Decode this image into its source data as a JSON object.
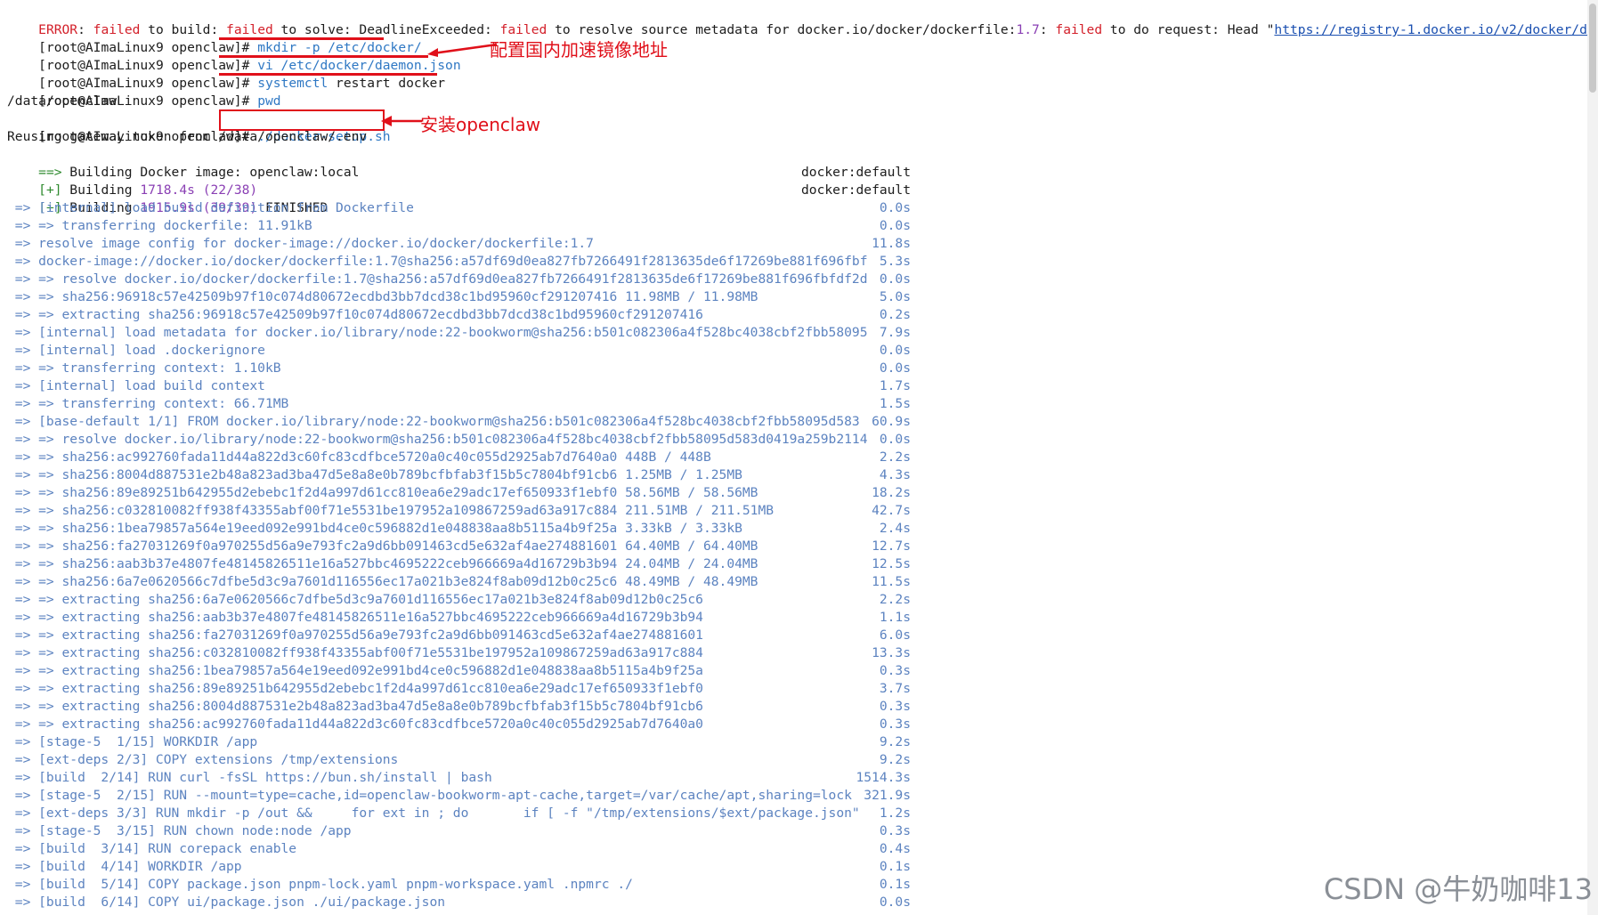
{
  "error_line": {
    "label": "ERROR",
    "parts": [
      [
        ": ",
        "black"
      ],
      [
        "failed",
        "red"
      ],
      [
        " to build: ",
        "black"
      ],
      [
        "failed",
        "red"
      ],
      [
        " to solve: DeadlineExceeded: ",
        "black"
      ],
      [
        "failed",
        "red"
      ],
      [
        " to resolve source metadata for docker.io/docker/dockerfile:",
        "black"
      ],
      [
        "1.7",
        "purple"
      ],
      [
        ": ",
        "black"
      ],
      [
        "failed",
        "red"
      ],
      [
        " to do request: Head \"",
        "black"
      ]
    ],
    "url": "https://registry-1.docker.io/v2/docker/docke"
  },
  "prompt": "[root@AImaLinux9 openclaw]",
  "commands": [
    {
      "cmd": "mkdir",
      "args": " -p /etc/docker/"
    },
    {
      "cmd": "vi",
      "args": " /etc/docker/daemon.json"
    },
    {
      "cmd": "systemctl",
      "args": " restart docker"
    },
    {
      "cmd": "pwd",
      "args": ""
    }
  ],
  "pwd_output": "/data/openclaw",
  "setup_cmd": "./docker-setup.sh",
  "reuse_line": "Reusing gateway token from /data/openclaw/.env",
  "building_image": {
    "prefix": "==>",
    "text": " Building Docker image: openclaw:local"
  },
  "progress": [
    {
      "tag": "[+]",
      "label": " Building ",
      "time": "1718.4s",
      "count": "(22/38)",
      "suffix": "",
      "ctx": "docker:default"
    },
    {
      "tag": "[+]",
      "label": " Building ",
      "time": "1915.9s",
      "count": "(39/39)",
      "suffix": " FINISHED",
      "ctx": "docker:default"
    }
  ],
  "steps": [
    {
      "text": " => [internal] load build definition from Dockerfile",
      "time": "0.0s"
    },
    {
      "text": " => => transferring dockerfile: 11.91kB",
      "time": "0.0s"
    },
    {
      "text": " => resolve image config for docker-image://docker.io/docker/dockerfile:1.7",
      "time": "11.8s"
    },
    {
      "text": " => docker-image://docker.io/docker/dockerfile:1.7@sha256:a57df69d0ea827fb7266491f2813635de6f17269be881f696fbf",
      "time": "5.3s"
    },
    {
      "text": " => => resolve docker.io/docker/dockerfile:1.7@sha256:a57df69d0ea827fb7266491f2813635de6f17269be881f696fbfdf2d",
      "time": "0.0s"
    },
    {
      "text": " => => sha256:96918c57e42509b97f10c074d80672ecdbd3bb7dcd38c1bd95960cf291207416 11.98MB / 11.98MB",
      "time": "5.0s"
    },
    {
      "text": " => => extracting sha256:96918c57e42509b97f10c074d80672ecdbd3bb7dcd38c1bd95960cf291207416",
      "time": "0.2s"
    },
    {
      "text": " => [internal] load metadata for docker.io/library/node:22-bookworm@sha256:b501c082306a4f528bc4038cbf2fbb58095",
      "time": "7.9s"
    },
    {
      "text": " => [internal] load .dockerignore",
      "time": "0.0s"
    },
    {
      "text": " => => transferring context: 1.10kB",
      "time": "0.0s"
    },
    {
      "text": " => [internal] load build context",
      "time": "1.7s"
    },
    {
      "text": " => => transferring context: 66.71MB",
      "time": "1.5s"
    },
    {
      "text": " => [base-default 1/1] FROM docker.io/library/node:22-bookworm@sha256:b501c082306a4f528bc4038cbf2fbb58095d583",
      "time": "60.9s"
    },
    {
      "text": " => => resolve docker.io/library/node:22-bookworm@sha256:b501c082306a4f528bc4038cbf2fbb58095d583d0419a259b2114",
      "time": "0.0s"
    },
    {
      "text": " => => sha256:ac992760fada11d44a822d3c60fc83cdfbce5720a0c40c055d2925ab7d7640a0 448B / 448B",
      "time": "2.2s"
    },
    {
      "text": " => => sha256:8004d887531e2b48a823ad3ba47d5e8a8e0b789bcfbfab3f15b5c7804bf91cb6 1.25MB / 1.25MB",
      "time": "4.3s"
    },
    {
      "text": " => => sha256:89e89251b642955d2ebebc1f2d4a997d61cc810ea6e29adc17ef650933f1ebf0 58.56MB / 58.56MB",
      "time": "18.2s"
    },
    {
      "text": " => => sha256:c032810082ff938f43355abf00f71e5531be197952a109867259ad63a917c884 211.51MB / 211.51MB",
      "time": "42.7s"
    },
    {
      "text": " => => sha256:1bea79857a564e19eed092e991bd4ce0c596882d1e048838aa8b5115a4b9f25a 3.33kB / 3.33kB",
      "time": "2.4s"
    },
    {
      "text": " => => sha256:fa27031269f0a970255d56a9e793fc2a9d6bb091463cd5e632af4ae274881601 64.40MB / 64.40MB",
      "time": "12.7s"
    },
    {
      "text": " => => sha256:aab3b37e4807fe48145826511e16a527bbc4695222ceb966669a4d16729b3b94 24.04MB / 24.04MB",
      "time": "12.5s"
    },
    {
      "text": " => => sha256:6a7e0620566c7dfbe5d3c9a7601d116556ec17a021b3e824f8ab09d12b0c25c6 48.49MB / 48.49MB",
      "time": "11.5s"
    },
    {
      "text": " => => extracting sha256:6a7e0620566c7dfbe5d3c9a7601d116556ec17a021b3e824f8ab09d12b0c25c6",
      "time": "2.2s"
    },
    {
      "text": " => => extracting sha256:aab3b37e4807fe48145826511e16a527bbc4695222ceb966669a4d16729b3b94",
      "time": "1.1s"
    },
    {
      "text": " => => extracting sha256:fa27031269f0a970255d56a9e793fc2a9d6bb091463cd5e632af4ae274881601",
      "time": "6.0s"
    },
    {
      "text": " => => extracting sha256:c032810082ff938f43355abf00f71e5531be197952a109867259ad63a917c884",
      "time": "13.3s"
    },
    {
      "text": " => => extracting sha256:1bea79857a564e19eed092e991bd4ce0c596882d1e048838aa8b5115a4b9f25a",
      "time": "0.3s"
    },
    {
      "text": " => => extracting sha256:89e89251b642955d2ebebc1f2d4a997d61cc810ea6e29adc17ef650933f1ebf0",
      "time": "3.7s"
    },
    {
      "text": " => => extracting sha256:8004d887531e2b48a823ad3ba47d5e8a8e0b789bcfbfab3f15b5c7804bf91cb6",
      "time": "0.3s"
    },
    {
      "text": " => => extracting sha256:ac992760fada11d44a822d3c60fc83cdfbce5720a0c40c055d2925ab7d7640a0",
      "time": "0.3s"
    },
    {
      "text": " => [stage-5  1/15] WORKDIR /app",
      "time": "9.2s"
    },
    {
      "text": " => [ext-deps 2/3] COPY extensions /tmp/extensions",
      "time": "9.2s"
    },
    {
      "text": " => [build  2/14] RUN curl -fsSL https://bun.sh/install | bash",
      "time": "1514.3s"
    },
    {
      "text": " => [stage-5  2/15] RUN --mount=type=cache,id=openclaw-bookworm-apt-cache,target=/var/cache/apt,sharing=lock",
      "time": "321.9s"
    },
    {
      "text": " => [ext-deps 3/3] RUN mkdir -p /out &&     for ext in ; do       if [ -f \"/tmp/extensions/$ext/package.json\"",
      "time": "1.2s"
    },
    {
      "text": " => [stage-5  3/15] RUN chown node:node /app",
      "time": "0.3s"
    },
    {
      "text": " => [build  3/14] RUN corepack enable",
      "time": "0.4s"
    },
    {
      "text": " => [build  4/14] WORKDIR /app",
      "time": "0.1s"
    },
    {
      "text": " => [build  5/14] COPY package.json pnpm-lock.yaml pnpm-workspace.yaml .npmrc ./",
      "time": "0.1s"
    },
    {
      "text": " => [build  6/14] COPY ui/package.json ./ui/package.json",
      "time": "0.0s"
    }
  ],
  "annotations": {
    "mirror_note": "配置国内加速镜像地址",
    "install_note": "安装openclaw"
  },
  "watermark": "CSDN @牛奶咖啡13"
}
